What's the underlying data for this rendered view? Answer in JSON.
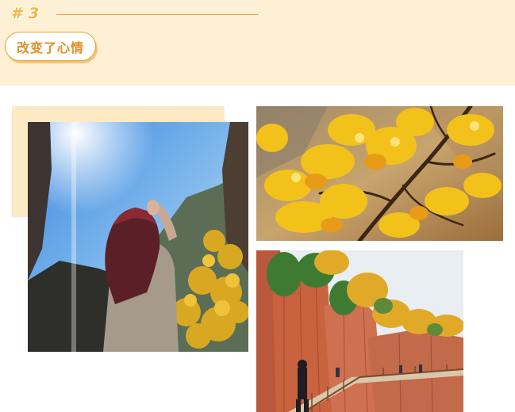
{
  "header": {
    "section_number": "# 3",
    "title": "改变了心情"
  },
  "colors": {
    "header_band": "#fdf0d5",
    "accent": "#e08f24",
    "section_number": "#f4b63e",
    "deco_block": "#fde9c4"
  },
  "gallery": {
    "photos": [
      {
        "subject": "woman-waving-at-sun-in-canyon"
      },
      {
        "subject": "autumn-yellow-leaves-branch"
      },
      {
        "subject": "red-cliff-walkway-with-tourists"
      }
    ]
  }
}
